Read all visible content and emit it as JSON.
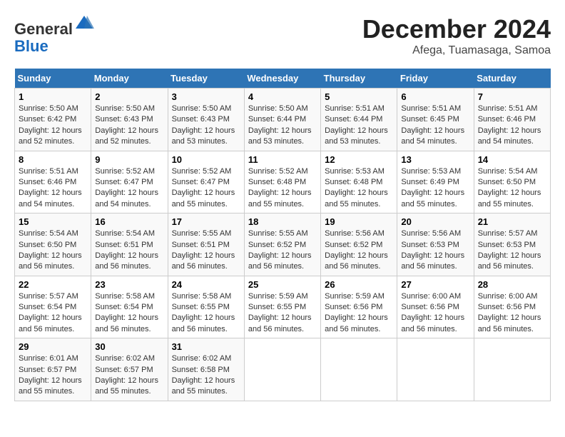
{
  "header": {
    "logo_line1": "General",
    "logo_line2": "Blue",
    "month": "December 2024",
    "location": "Afega, Tuamasaga, Samoa"
  },
  "weekdays": [
    "Sunday",
    "Monday",
    "Tuesday",
    "Wednesday",
    "Thursday",
    "Friday",
    "Saturday"
  ],
  "weeks": [
    [
      {
        "day": "1",
        "sunrise": "5:50 AM",
        "sunset": "6:42 PM",
        "daylight": "12 hours and 52 minutes."
      },
      {
        "day": "2",
        "sunrise": "5:50 AM",
        "sunset": "6:43 PM",
        "daylight": "12 hours and 52 minutes."
      },
      {
        "day": "3",
        "sunrise": "5:50 AM",
        "sunset": "6:43 PM",
        "daylight": "12 hours and 53 minutes."
      },
      {
        "day": "4",
        "sunrise": "5:50 AM",
        "sunset": "6:44 PM",
        "daylight": "12 hours and 53 minutes."
      },
      {
        "day": "5",
        "sunrise": "5:51 AM",
        "sunset": "6:44 PM",
        "daylight": "12 hours and 53 minutes."
      },
      {
        "day": "6",
        "sunrise": "5:51 AM",
        "sunset": "6:45 PM",
        "daylight": "12 hours and 54 minutes."
      },
      {
        "day": "7",
        "sunrise": "5:51 AM",
        "sunset": "6:46 PM",
        "daylight": "12 hours and 54 minutes."
      }
    ],
    [
      {
        "day": "8",
        "sunrise": "5:51 AM",
        "sunset": "6:46 PM",
        "daylight": "12 hours and 54 minutes."
      },
      {
        "day": "9",
        "sunrise": "5:52 AM",
        "sunset": "6:47 PM",
        "daylight": "12 hours and 54 minutes."
      },
      {
        "day": "10",
        "sunrise": "5:52 AM",
        "sunset": "6:47 PM",
        "daylight": "12 hours and 55 minutes."
      },
      {
        "day": "11",
        "sunrise": "5:52 AM",
        "sunset": "6:48 PM",
        "daylight": "12 hours and 55 minutes."
      },
      {
        "day": "12",
        "sunrise": "5:53 AM",
        "sunset": "6:48 PM",
        "daylight": "12 hours and 55 minutes."
      },
      {
        "day": "13",
        "sunrise": "5:53 AM",
        "sunset": "6:49 PM",
        "daylight": "12 hours and 55 minutes."
      },
      {
        "day": "14",
        "sunrise": "5:54 AM",
        "sunset": "6:50 PM",
        "daylight": "12 hours and 55 minutes."
      }
    ],
    [
      {
        "day": "15",
        "sunrise": "5:54 AM",
        "sunset": "6:50 PM",
        "daylight": "12 hours and 56 minutes."
      },
      {
        "day": "16",
        "sunrise": "5:54 AM",
        "sunset": "6:51 PM",
        "daylight": "12 hours and 56 minutes."
      },
      {
        "day": "17",
        "sunrise": "5:55 AM",
        "sunset": "6:51 PM",
        "daylight": "12 hours and 56 minutes."
      },
      {
        "day": "18",
        "sunrise": "5:55 AM",
        "sunset": "6:52 PM",
        "daylight": "12 hours and 56 minutes."
      },
      {
        "day": "19",
        "sunrise": "5:56 AM",
        "sunset": "6:52 PM",
        "daylight": "12 hours and 56 minutes."
      },
      {
        "day": "20",
        "sunrise": "5:56 AM",
        "sunset": "6:53 PM",
        "daylight": "12 hours and 56 minutes."
      },
      {
        "day": "21",
        "sunrise": "5:57 AM",
        "sunset": "6:53 PM",
        "daylight": "12 hours and 56 minutes."
      }
    ],
    [
      {
        "day": "22",
        "sunrise": "5:57 AM",
        "sunset": "6:54 PM",
        "daylight": "12 hours and 56 minutes."
      },
      {
        "day": "23",
        "sunrise": "5:58 AM",
        "sunset": "6:54 PM",
        "daylight": "12 hours and 56 minutes."
      },
      {
        "day": "24",
        "sunrise": "5:58 AM",
        "sunset": "6:55 PM",
        "daylight": "12 hours and 56 minutes."
      },
      {
        "day": "25",
        "sunrise": "5:59 AM",
        "sunset": "6:55 PM",
        "daylight": "12 hours and 56 minutes."
      },
      {
        "day": "26",
        "sunrise": "5:59 AM",
        "sunset": "6:56 PM",
        "daylight": "12 hours and 56 minutes."
      },
      {
        "day": "27",
        "sunrise": "6:00 AM",
        "sunset": "6:56 PM",
        "daylight": "12 hours and 56 minutes."
      },
      {
        "day": "28",
        "sunrise": "6:00 AM",
        "sunset": "6:56 PM",
        "daylight": "12 hours and 56 minutes."
      }
    ],
    [
      {
        "day": "29",
        "sunrise": "6:01 AM",
        "sunset": "6:57 PM",
        "daylight": "12 hours and 55 minutes."
      },
      {
        "day": "30",
        "sunrise": "6:02 AM",
        "sunset": "6:57 PM",
        "daylight": "12 hours and 55 minutes."
      },
      {
        "day": "31",
        "sunrise": "6:02 AM",
        "sunset": "6:58 PM",
        "daylight": "12 hours and 55 minutes."
      },
      null,
      null,
      null,
      null
    ]
  ]
}
